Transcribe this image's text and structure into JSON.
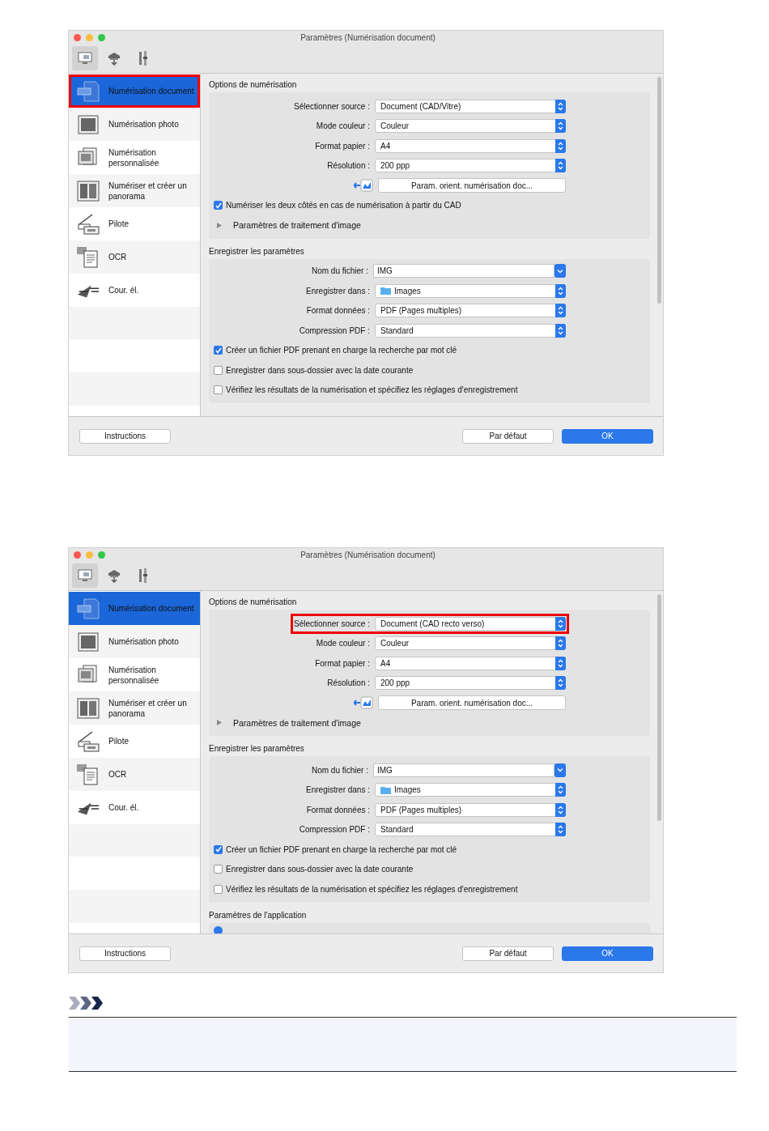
{
  "dialogs": [
    {
      "title": "Paramètres (Numérisation document)",
      "toolbar_tabs": [
        {
          "selected": true
        },
        {
          "selected": false
        },
        {
          "selected": false
        }
      ],
      "sidebar": [
        {
          "label": "Numérisation document",
          "selected": true,
          "highlighted": true
        },
        {
          "label": "Numérisation photo",
          "selected": false,
          "highlighted": false
        },
        {
          "label": "Numérisation personnalisée",
          "selected": false,
          "highlighted": false
        },
        {
          "label": "Numériser et créer un panorama",
          "selected": false,
          "highlighted": false
        },
        {
          "label": "Pilote",
          "selected": false,
          "highlighted": false
        },
        {
          "label": "OCR",
          "selected": false,
          "highlighted": false
        },
        {
          "label": "Cour. él.",
          "selected": false,
          "highlighted": false
        }
      ],
      "sections": [
        {
          "heading": "Options de numérisation",
          "items": [
            {
              "kind": "select",
              "label": "Sélectionner source :",
              "value": "Document (CAD/Vitre)",
              "highlighted": false
            },
            {
              "kind": "select",
              "label": "Mode couleur :",
              "value": "Couleur",
              "highlighted": false
            },
            {
              "kind": "select",
              "label": "Format papier :",
              "value": "A4",
              "highlighted": false
            },
            {
              "kind": "select",
              "label": "Résolution :",
              "value": "200 ppp",
              "highlighted": false
            },
            {
              "kind": "button",
              "label": "Param. orient. numérisation doc..."
            },
            {
              "kind": "checkbox",
              "label": "Numériser les deux côtés en cas de numérisation à partir du CAD",
              "checked": true
            },
            {
              "kind": "disclosure",
              "label": "Paramètres de traitement d'image",
              "expanded": false
            }
          ]
        },
        {
          "heading": "Enregistrer les paramètres",
          "items": [
            {
              "kind": "combo",
              "label": "Nom du fichier :",
              "value": "IMG"
            },
            {
              "kind": "folder",
              "label": "Enregistrer dans :",
              "value": "Images",
              "highlighted": false
            },
            {
              "kind": "select",
              "label": "Format données :",
              "value": "PDF (Pages multiples)",
              "highlighted": false
            },
            {
              "kind": "select",
              "label": "Compression PDF :",
              "value": "Standard",
              "highlighted": false
            },
            {
              "kind": "checkbox",
              "label": "Créer un fichier PDF prenant en charge la recherche par mot clé",
              "checked": true
            },
            {
              "kind": "checkbox",
              "label": "Enregistrer dans sous-dossier avec la date courante",
              "checked": false
            },
            {
              "kind": "checkbox",
              "label": "Vérifiez les résultats de la numérisation et spécifiez les réglages d'enregistrement",
              "checked": false
            }
          ]
        }
      ],
      "footer_left": [
        {
          "label": "Instructions",
          "primary": false
        }
      ],
      "footer_right": [
        {
          "label": "Par défaut",
          "primary": false
        },
        {
          "label": "OK",
          "primary": true
        }
      ]
    },
    {
      "title": "Paramètres (Numérisation document)",
      "toolbar_tabs": [
        {
          "selected": true
        },
        {
          "selected": false
        },
        {
          "selected": false
        }
      ],
      "sidebar": [
        {
          "label": "Numérisation document",
          "selected": true,
          "highlighted": false
        },
        {
          "label": "Numérisation photo",
          "selected": false,
          "highlighted": false
        },
        {
          "label": "Numérisation personnalisée",
          "selected": false,
          "highlighted": false
        },
        {
          "label": "Numériser et créer un panorama",
          "selected": false,
          "highlighted": false
        },
        {
          "label": "Pilote",
          "selected": false,
          "highlighted": false
        },
        {
          "label": "OCR",
          "selected": false,
          "highlighted": false
        },
        {
          "label": "Cour. él.",
          "selected": false,
          "highlighted": false
        }
      ],
      "sections": [
        {
          "heading": "Options de numérisation",
          "items": [
            {
              "kind": "select",
              "label": "Sélectionner source :",
              "value": "Document (CAD recto verso)",
              "highlighted": true
            },
            {
              "kind": "select",
              "label": "Mode couleur :",
              "value": "Couleur",
              "highlighted": false
            },
            {
              "kind": "select",
              "label": "Format papier :",
              "value": "A4",
              "highlighted": false
            },
            {
              "kind": "select",
              "label": "Résolution :",
              "value": "200 ppp",
              "highlighted": false
            },
            {
              "kind": "button",
              "label": "Param. orient. numérisation doc..."
            },
            {
              "kind": "disclosure",
              "label": "Paramètres de traitement d'image",
              "expanded": false
            }
          ]
        },
        {
          "heading": "Enregistrer les paramètres",
          "items": [
            {
              "kind": "combo",
              "label": "Nom du fichier :",
              "value": "IMG"
            },
            {
              "kind": "folder",
              "label": "Enregistrer dans :",
              "value": "Images",
              "highlighted": false
            },
            {
              "kind": "select",
              "label": "Format données :",
              "value": "PDF (Pages multiples)",
              "highlighted": false
            },
            {
              "kind": "select",
              "label": "Compression PDF :",
              "value": "Standard",
              "highlighted": false
            },
            {
              "kind": "checkbox",
              "label": "Créer un fichier PDF prenant en charge la recherche par mot clé",
              "checked": true
            },
            {
              "kind": "checkbox",
              "label": "Enregistrer dans sous-dossier avec la date courante",
              "checked": false
            },
            {
              "kind": "checkbox",
              "label": "Vérifiez les résultats de la numérisation et spécifiez les réglages d'enregistrement",
              "checked": false
            }
          ]
        },
        {
          "heading": "Paramètres de l'application",
          "items": [
            {
              "kind": "radio",
              "checked": true
            }
          ]
        }
      ],
      "footer_left": [
        {
          "label": "Instructions",
          "primary": false
        }
      ],
      "footer_right": [
        {
          "label": "Par défaut",
          "primary": false
        },
        {
          "label": "OK",
          "primary": true
        }
      ]
    }
  ]
}
